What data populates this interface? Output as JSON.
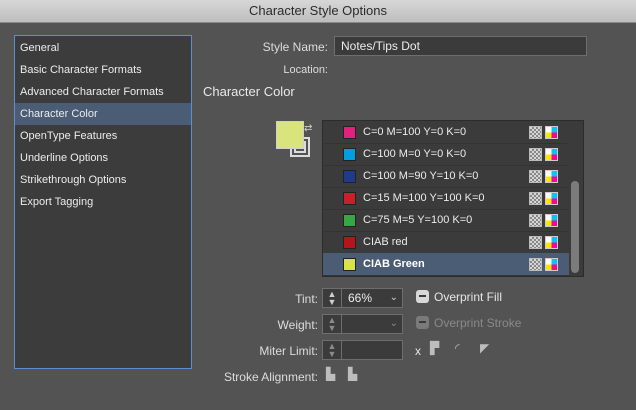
{
  "window": {
    "title": "Character Style Options"
  },
  "sidebar": {
    "items": [
      {
        "label": "General"
      },
      {
        "label": "Basic Character Formats"
      },
      {
        "label": "Advanced Character Formats"
      },
      {
        "label": "Character Color",
        "selected": true
      },
      {
        "label": "OpenType Features"
      },
      {
        "label": "Underline Options"
      },
      {
        "label": "Strikethrough Options"
      },
      {
        "label": "Export Tagging"
      }
    ]
  },
  "form": {
    "style_name_label": "Style Name:",
    "style_name_value": "Notes/Tips Dot",
    "location_label": "Location:",
    "section_title": "Character Color"
  },
  "swatches": {
    "items": [
      {
        "name": "C=0 M=100 Y=0 K=0",
        "color": "#e4207c"
      },
      {
        "name": "C=100 M=0 Y=0 K=0",
        "color": "#00a0e0"
      },
      {
        "name": "C=100 M=90 Y=10 K=0",
        "color": "#1f3a8a"
      },
      {
        "name": "C=15 M=100 Y=100 K=0",
        "color": "#c8202a"
      },
      {
        "name": "C=75 M=5 Y=100 K=0",
        "color": "#35a745"
      },
      {
        "name": "CIAB red",
        "color": "#b8121b"
      },
      {
        "name": "CIAB Green",
        "color": "#d6e34a",
        "selected": true
      }
    ],
    "fill_color": "#d9e57c"
  },
  "controls": {
    "tint_label": "Tint:",
    "tint_value": "66%",
    "overprint_fill_label": "Overprint Fill",
    "weight_label": "Weight:",
    "overprint_stroke_label": "Overprint Stroke",
    "miter_label": "Miter Limit:",
    "miter_x": "x",
    "stroke_alignment_label": "Stroke Alignment:"
  },
  "icons": {
    "spinner": "up-down-arrows-icon",
    "dropdown": "chevron-down-icon",
    "swap": "swap-arrows-icon",
    "swatch_type": "process-color-icon",
    "color_mode": "cmyk-icon",
    "join": "stroke-join-icon",
    "align": "stroke-align-icon"
  }
}
